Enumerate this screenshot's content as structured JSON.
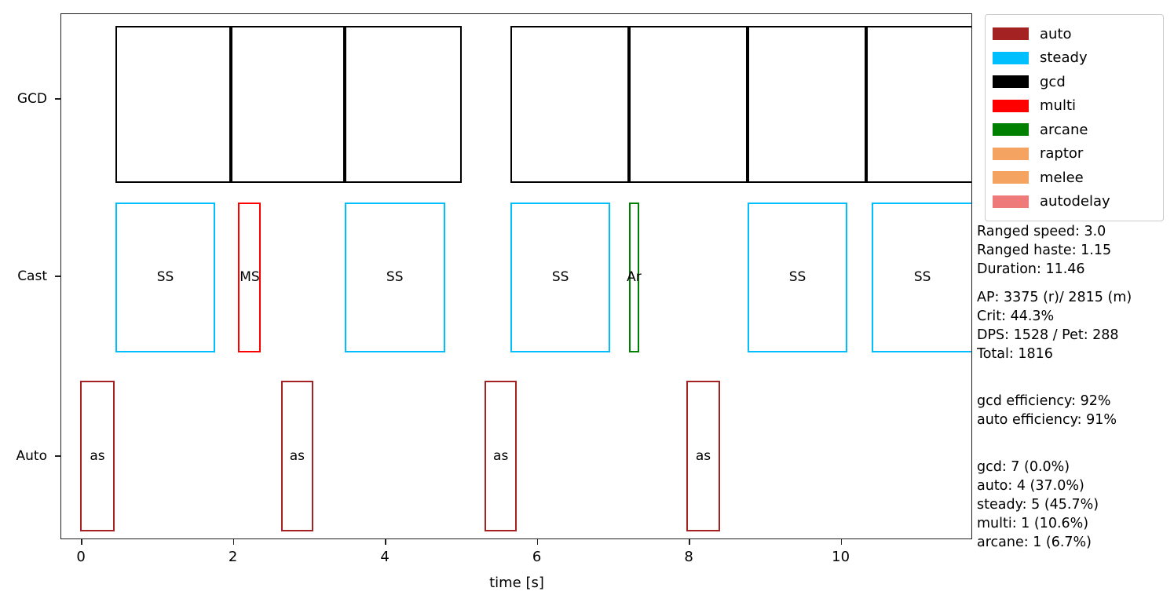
{
  "chart_data": {
    "type": "table",
    "title": "",
    "xlabel": "time [s]",
    "ylabel": "",
    "xlim": [
      -0.27,
      11.73
    ],
    "xticks": [
      "0",
      "2",
      "4",
      "6",
      "8",
      "10"
    ],
    "xtick_values": [
      0,
      2,
      4,
      6,
      8,
      10
    ],
    "yticks": [
      "GCD",
      "Cast",
      "Auto"
    ],
    "grid": false,
    "legend_position": "upper right outside",
    "rows": [
      {
        "name": "GCD",
        "color": "#000000",
        "bars": [
          {
            "label": "",
            "start": 0.44,
            "end": 1.96
          },
          {
            "label": "",
            "start": 1.96,
            "end": 3.46
          },
          {
            "label": "",
            "start": 3.46,
            "end": 5.0
          },
          {
            "label": "",
            "start": 5.64,
            "end": 7.2
          },
          {
            "label": "",
            "start": 7.2,
            "end": 8.76
          },
          {
            "label": "",
            "start": 8.76,
            "end": 10.32
          },
          {
            "label": "",
            "start": 10.32,
            "end": 11.73
          }
        ]
      },
      {
        "name": "Cast",
        "bars": [
          {
            "label": "SS",
            "start": 0.44,
            "end": 1.76,
            "color": "#00bfff",
            "series": "steady"
          },
          {
            "label": "MS",
            "start": 2.06,
            "end": 2.36,
            "color": "#ff0000",
            "series": "multi"
          },
          {
            "label": "SS",
            "start": 3.46,
            "end": 4.78,
            "color": "#00bfff",
            "series": "steady"
          },
          {
            "label": "SS",
            "start": 5.64,
            "end": 6.96,
            "color": "#00bfff",
            "series": "steady"
          },
          {
            "label": "Ar",
            "start": 7.2,
            "end": 7.34,
            "color": "#008000",
            "series": "arcane"
          },
          {
            "label": "SS",
            "start": 8.76,
            "end": 10.08,
            "color": "#00bfff",
            "series": "steady"
          },
          {
            "label": "SS",
            "start": 10.4,
            "end": 11.73,
            "color": "#00bfff",
            "series": "steady"
          }
        ]
      },
      {
        "name": "Auto",
        "color": "#a52222",
        "bars": [
          {
            "label": "as",
            "start": -0.02,
            "end": 0.43
          },
          {
            "label": "as",
            "start": 2.62,
            "end": 3.05
          },
          {
            "label": "as",
            "start": 5.3,
            "end": 5.73
          },
          {
            "label": "as",
            "start": 7.96,
            "end": 8.4
          }
        ]
      }
    ]
  },
  "legend": {
    "items": [
      {
        "label": "auto",
        "color": "#a52222"
      },
      {
        "label": "steady",
        "color": "#00bfff"
      },
      {
        "label": "gcd",
        "color": "#000000"
      },
      {
        "label": "multi",
        "color": "#ff0000"
      },
      {
        "label": "arcane",
        "color": "#008000"
      },
      {
        "label": "raptor",
        "color": "#f4a460"
      },
      {
        "label": "melee",
        "color": "#f4a460"
      },
      {
        "label": "autodelay",
        "color": "#ef7a7a"
      }
    ]
  },
  "stats": {
    "group1": [
      "Ranged speed: 3.0",
      "Ranged haste: 1.15",
      "Duration: 11.46"
    ],
    "group2": [
      "AP: 3375 (r)/ 2815 (m)",
      "Crit: 44.3%",
      "DPS: 1528 / Pet: 288",
      "Total: 1816"
    ],
    "group3": [
      "gcd efficiency: 92%",
      "auto efficiency: 91%"
    ],
    "group4": [
      "gcd: 7 (0.0%)",
      "auto: 4 (37.0%)",
      "steady: 5 (45.7%)",
      "multi: 1 (10.6%)",
      "arcane: 1 (6.7%)"
    ]
  }
}
